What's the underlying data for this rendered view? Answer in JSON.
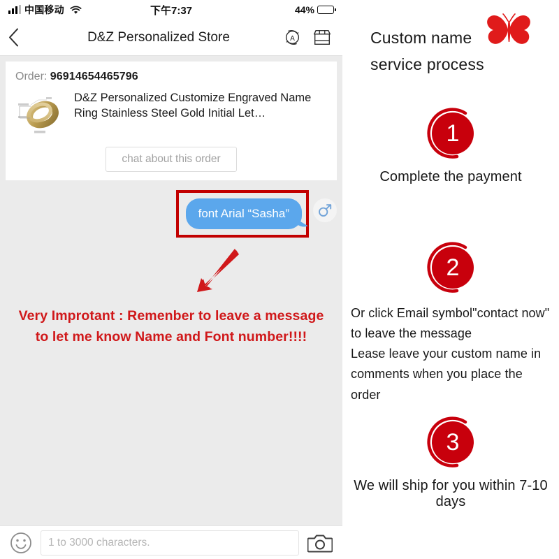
{
  "status_bar": {
    "carrier": "中国移动",
    "time": "下午7:37",
    "battery_percent": "44%",
    "battery_level": 44,
    "signal_icon": "signal-bars-icon",
    "wifi_icon": "wifi-icon"
  },
  "nav_bar": {
    "back_icon": "chevron-left-icon",
    "title": "D&Z Personalized Store",
    "translate_icon": "auto-translate-icon",
    "store_icon": "storefront-icon"
  },
  "order_card": {
    "order_label": "Order: ",
    "order_number": "96914654465796",
    "product_title": "D&Z Personalized Customize Engraved Name Ring Stainless Steel Gold Initial Let…",
    "product_thumb_icon": "gold-ring-product-image",
    "chat_button": "chat about this order"
  },
  "message": {
    "bubble_text": "font Arial “Sasha”",
    "bubble_color": "#5ba7ec",
    "highlight_color": "#c20000",
    "avatar_icon": "male-gender-symbol-icon"
  },
  "annotation": {
    "arrow_icon": "red-arrow-down-left-icon",
    "arrow_color": "#d0181a",
    "warning_line_1": "Very Improtant : Remenber to leave a message",
    "warning_line_2": "to let me know Name and Font number!!!!",
    "warning_color": "#d0181a"
  },
  "input_bar": {
    "emoji_icon": "smiley-face-icon",
    "placeholder": "1 to 3000 characters.",
    "value": "",
    "camera_icon": "camera-icon"
  },
  "process": {
    "heading": "Custom name\nservice process",
    "butterfly_icon": "red-butterfly-icon",
    "accent_color": "#c8000c",
    "steps": [
      {
        "number": "1",
        "caption": "Complete the payment",
        "lines": [
          "Complete the payment"
        ],
        "align": "center"
      },
      {
        "number": "2",
        "caption": "Or click Email symbol\"contact now\" to leave the message Lease leave your custom name in comments when you place the order",
        "lines": [
          "Or click Email symbol\"contact now\" to leave the message",
          "Lease leave your custom name in comments when you place the order"
        ],
        "align": "left"
      },
      {
        "number": "3",
        "caption": "We will ship for you within 7-10 days",
        "lines": [
          "We will ship for you within 7-10 days"
        ],
        "align": "center"
      }
    ]
  }
}
